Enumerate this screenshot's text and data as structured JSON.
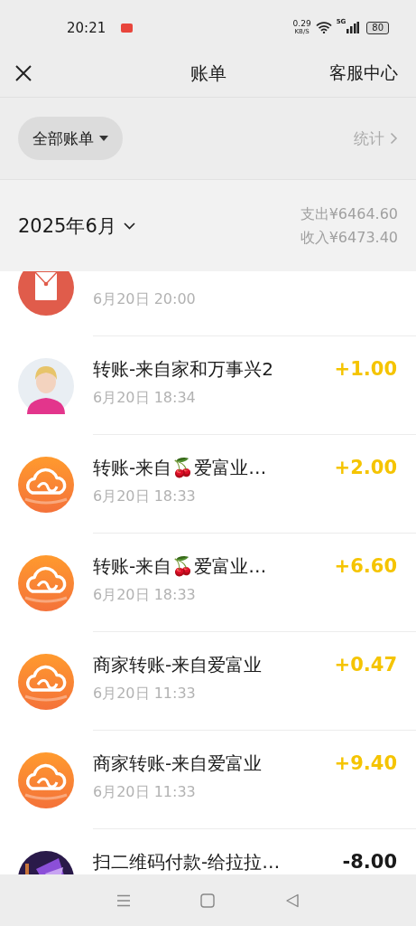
{
  "status_bar": {
    "time": "20:21",
    "speed": "0.29",
    "speed_unit": "KB/S",
    "network": "5G",
    "battery": "80"
  },
  "header": {
    "title": "账单",
    "action": "客服中心"
  },
  "filter": {
    "label": "全部账单",
    "stats": "统计"
  },
  "month": {
    "label": "2025年6月",
    "expense": "支出¥6464.60",
    "income": "收入¥6473.40"
  },
  "transactions": [
    {
      "kind": "envelope",
      "time": "6月20日 20:00"
    },
    {
      "kind": "picture",
      "title": "转账-来自家和万事兴2",
      "amount": "+1.00",
      "color": "#f5c400",
      "time": "6月20日 18:34"
    },
    {
      "kind": "cloud",
      "title": "转账-来自🍒爱富业…",
      "amount": "+2.00",
      "color": "#f5c400",
      "time": "6月20日 18:33"
    },
    {
      "kind": "cloud",
      "title": "转账-来自🍒爱富业…",
      "amount": "+6.60",
      "color": "#f5c400",
      "time": "6月20日 18:33"
    },
    {
      "kind": "cloud",
      "title": "商家转账-来自爱富业",
      "amount": "+0.47",
      "color": "#f5c400",
      "time": "6月20日 11:33"
    },
    {
      "kind": "cloud",
      "title": "商家转账-来自爱富业",
      "amount": "+9.40",
      "color": "#f5c400",
      "time": "6月20日 11:33"
    },
    {
      "kind": "picture",
      "title": "扫二维码付款-给拉拉…",
      "amount": "-8.00",
      "color": "#1a1a1a"
    }
  ]
}
